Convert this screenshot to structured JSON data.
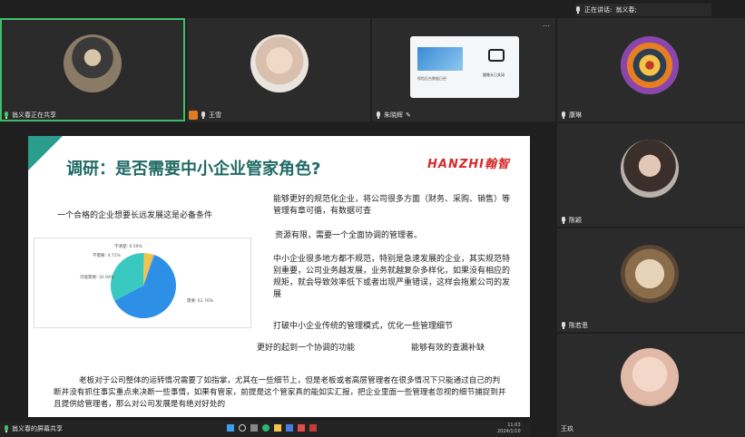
{
  "tiles": [
    {
      "name": "翁义春正在共享"
    },
    {
      "name": "王雪"
    },
    {
      "name": "朱晓辉"
    },
    {
      "name": "康琳"
    }
  ],
  "speaking": {
    "label": "正在讲话:",
    "speaker": "翁义春;"
  },
  "thumb_card": {
    "caption": "保险后台数据已经",
    "title": "摄像头已关闭"
  },
  "side_participants": [
    {
      "name": "陈颖"
    },
    {
      "name": "陈若恩"
    },
    {
      "name": "王玖"
    }
  ],
  "screen_share_label": "翁义春的屏幕共享",
  "slide": {
    "title": "调研：是否需要中小企业管家角色?",
    "brand": "HANZHI翰智",
    "left_heading": "一个合格的企业想要长远发展这是必备条件",
    "para1": "能够更好的规范化企业，将公司很多方面（财务、采购、销售）等管理有章可循，有数据可查",
    "para2": "资源有限，需要一个全面协调的管理者。",
    "para3": "中小企业很多地方都不规范，特别是急速发展的企业，其实规范特别重要，公司业务越发展，业务就越复杂多样化，如果没有相应的规矩，就会导致效率低下或者出现严重错误，这样会拖累公司的发展",
    "para4": "打破中小企业传统的管理模式，优化一些管理细节",
    "para5a": "更好的起到一个协调的功能",
    "para5b": "能够有效的查漏补缺",
    "bottom": "老板对于公司整体的运转情况需要了如指掌，尤其在一些细节上，但是老板或者高层管理者在很多情况下只能通过自己的判断并没有抓住事实重点来决断一些事情，如果有管家，前提是这个管家真的能如实汇报，把企业里面一些管理者忽视的细节捕捉到并且提供给管理者，那么对公司发展是有绝对好处的"
  },
  "chart_data": {
    "type": "pie",
    "categories": [
      "需要",
      "可能需要",
      "不需要"
    ],
    "labels": [
      "需要: 61.76%",
      "可能需要: 32.94%",
      "不需要: 4.71%",
      "不清楚: 0.59%"
    ],
    "values": [
      61.76,
      32.94,
      4.71,
      0.59
    ],
    "colors": [
      "#2e8fe6",
      "#39c9c1",
      "#f2c44b",
      "#9aa3ad"
    ]
  },
  "taskbar": {
    "time": "11:03",
    "date": "2024/1/10"
  }
}
